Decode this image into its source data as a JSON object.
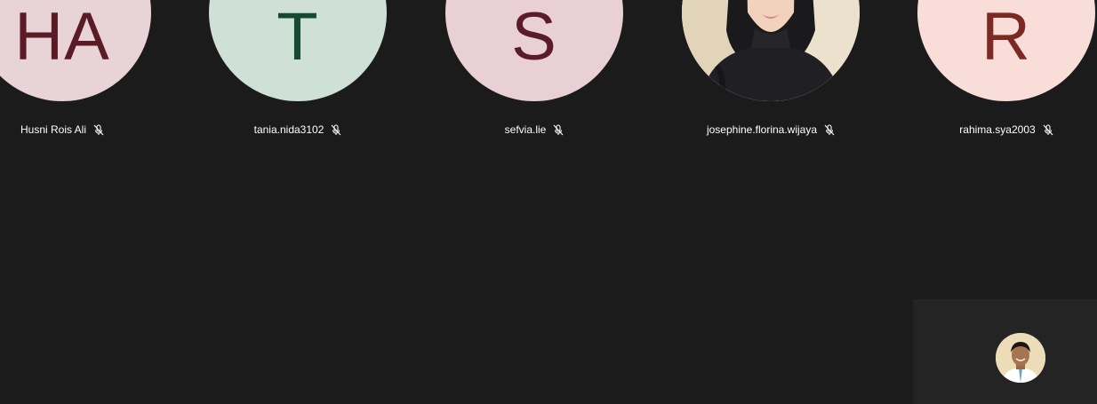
{
  "participants": [
    {
      "name": "Husni Rois Ali",
      "initials": "HA",
      "bg": "#e8d3d6",
      "fg": "#5a1a26",
      "mic": "mic-off-icon"
    },
    {
      "name": "tania.nida3102",
      "initials": "T",
      "bg": "#cfe0d7",
      "fg": "#164a30",
      "mic": "mic-off-icon"
    },
    {
      "name": "sefvia.lie",
      "initials": "S",
      "bg": "#e8d0d4",
      "fg": "#5c1b2a",
      "mic": "mic-off-icon"
    },
    {
      "name": "josephine.florina.wijaya",
      "initials": "",
      "bg": "#e8dcc6",
      "fg": "#000000",
      "mic": "mic-off-icon",
      "photo": true
    },
    {
      "name": "rahima.sya2003",
      "initials": "R",
      "bg": "#f9ddd8",
      "fg": "#7a2a22",
      "mic": "mic-off-icon"
    }
  ],
  "self_view": {
    "icon": "self-avatar-photo"
  },
  "colors": {
    "background": "#1b1b1b",
    "self_view_bg": "#242424",
    "label_text": "#ffffff"
  }
}
